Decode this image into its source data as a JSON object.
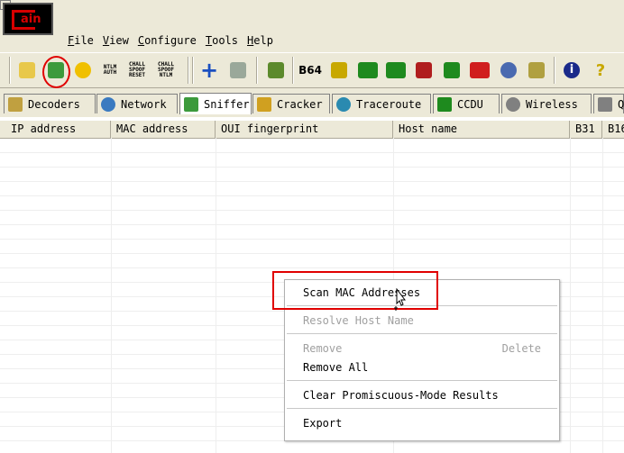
{
  "app": {
    "logo_text": "ain"
  },
  "menubar": {
    "items": [
      "File",
      "View",
      "Configure",
      "Tools",
      "Help"
    ],
    "underline": [
      "F",
      "V",
      "C",
      "T",
      "H"
    ]
  },
  "toolbar": {
    "buttons": [
      {
        "icon": "folder-icon",
        "color": "#e8c84a"
      },
      {
        "icon": "sniffer-start-icon",
        "color": "#3c9a3c"
      },
      {
        "icon": "radiation-icon",
        "color": "#f0c000"
      },
      {
        "icon": "ntlm-auth-icon",
        "text": "NTLM\nAUTH"
      },
      {
        "icon": "chall-spoof-reset-icon",
        "text": "CHALL\nSPOOF\nRESET"
      },
      {
        "icon": "chall-spoof-ntlm-icon",
        "text": "CHALL\nSPOOF\nNTLM"
      },
      {
        "icon": "add-icon",
        "color": "#1a4fc0"
      },
      {
        "icon": "recycle-icon",
        "color": "#7a8a7a"
      },
      {
        "icon": "scan-icon",
        "color": "#5c8a2c"
      },
      {
        "icon": "base64-icon",
        "text": "B64"
      },
      {
        "icon": "key-icon",
        "color": "#c8a800"
      },
      {
        "icon": "meter-icon",
        "color": "#1e8a1e"
      },
      {
        "icon": "vnc-icon",
        "color": "#1e8a1e"
      },
      {
        "icon": "nc-icon",
        "color": "#b01e1e"
      },
      {
        "icon": "monitor-icon",
        "color": "#1e8a1e"
      },
      {
        "icon": "window-icon",
        "color": "#d01e1e"
      },
      {
        "icon": "network-icon",
        "color": "#4a6ab0"
      },
      {
        "icon": "certificate-icon",
        "color": "#b0a040"
      },
      {
        "icon": "info-icon",
        "color": "#1a2a8a"
      },
      {
        "icon": "help-icon",
        "color": "#c8a800"
      }
    ]
  },
  "tabs": [
    {
      "label": "Decoders",
      "icon": "decoders-icon",
      "color": "#c0a040"
    },
    {
      "label": "Network",
      "icon": "network-globe-icon",
      "color": "#3a7ac0"
    },
    {
      "label": "Sniffer",
      "icon": "sniffer-icon",
      "color": "#3c9a3c",
      "active": true
    },
    {
      "label": "Cracker",
      "icon": "cracker-icon",
      "color": "#d0a020"
    },
    {
      "label": "Traceroute",
      "icon": "traceroute-icon",
      "color": "#2a8ab0"
    },
    {
      "label": "CCDU",
      "icon": "ccdu-icon",
      "color": "#1e8a1e"
    },
    {
      "label": "Wireless",
      "icon": "wireless-icon",
      "color": "#808080"
    },
    {
      "label": "Q",
      "icon": "query-icon",
      "color": "#808080"
    }
  ],
  "columns": [
    "IP address",
    "MAC address",
    "OUI fingerprint",
    "Host name",
    "B31",
    "B16"
  ],
  "context_menu": {
    "scan_mac": "Scan MAC Addresses",
    "resolve_host": "Resolve Host Name",
    "remove": "Remove",
    "remove_shortcut": "Delete",
    "remove_all": "Remove All",
    "clear_promisc": "Clear Promiscuous-Mode Results",
    "export": "Export"
  },
  "colors": {
    "highlight": "#e00000",
    "disabled": "#a0a0a0"
  }
}
